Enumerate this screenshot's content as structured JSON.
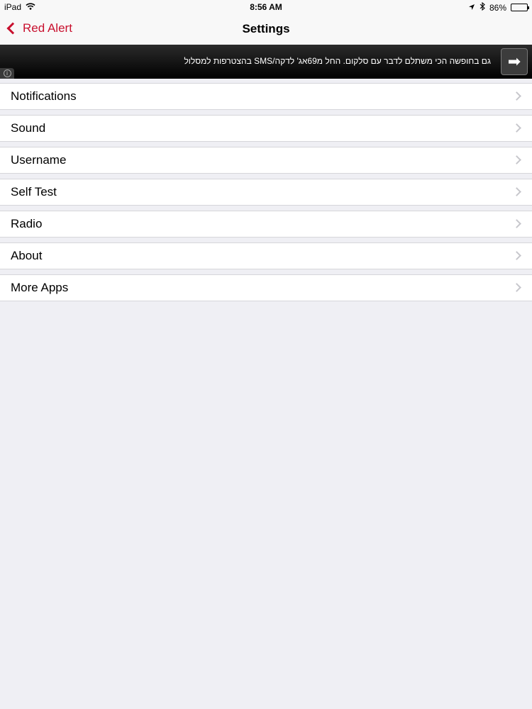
{
  "status_bar": {
    "device": "iPad",
    "wifi_icon": "wifi-icon",
    "time": "8:56 AM",
    "battery_percent": "86%",
    "battery_level": 0.86
  },
  "nav": {
    "back_label": "Red Alert",
    "title": "Settings"
  },
  "ad": {
    "text": "גם בחופשה הכי משתלם לדבר עם סלקום. החל מ69אג' לדקה/SMS בהצטרפות למסלול",
    "info_symbol": "i",
    "arrow_symbol": "➡"
  },
  "settings": {
    "items": [
      {
        "label": "Notifications"
      },
      {
        "label": "Sound"
      },
      {
        "label": "Username"
      },
      {
        "label": "Self Test"
      },
      {
        "label": "Radio"
      },
      {
        "label": "About"
      },
      {
        "label": "More Apps"
      }
    ]
  },
  "colors": {
    "accent": "#c8102e",
    "background": "#efeff4"
  }
}
